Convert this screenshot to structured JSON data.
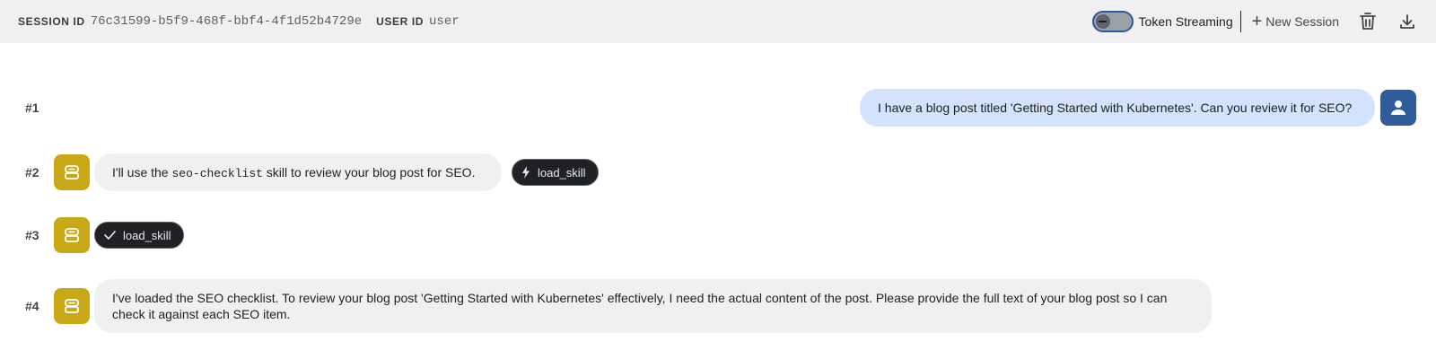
{
  "header": {
    "session_label": "SESSION ID",
    "session_id": "76c31599-b5f9-468f-bbf4-4f1d52b4729e",
    "user_label": "USER ID",
    "user_id": "user",
    "token_streaming_label": "Token Streaming",
    "new_session_label": "New Session",
    "icons": {
      "delete": "trash-icon",
      "download": "download-icon"
    }
  },
  "messages": [
    {
      "num": "#1",
      "role": "user",
      "text": "I have a blog post titled 'Getting Started with Kubernetes'. Can you review it for SEO?"
    },
    {
      "num": "#2",
      "role": "agent",
      "text_before": "I'll use the ",
      "code": "seo-checklist",
      "text_after": " skill to review your blog post for SEO.",
      "chip": {
        "label": "load_skill",
        "icon": "bolt-icon"
      }
    },
    {
      "num": "#3",
      "role": "agent",
      "chip": {
        "label": "load_skill",
        "icon": "check-icon"
      }
    },
    {
      "num": "#4",
      "role": "agent",
      "text": "I've loaded the SEO checklist. To review your blog post 'Getting Started with Kubernetes' effectively, I need the actual content of the post. Please provide the full text of your blog post so I can check it against each SEO item."
    }
  ],
  "colors": {
    "header_bg": "#f1f0f0",
    "agent_avatar": "#c9a817",
    "user_avatar": "#2f5c99",
    "user_bubble": "#d3e3fd",
    "agent_bubble": "#f1f0f0",
    "chip_bg": "#202124"
  }
}
